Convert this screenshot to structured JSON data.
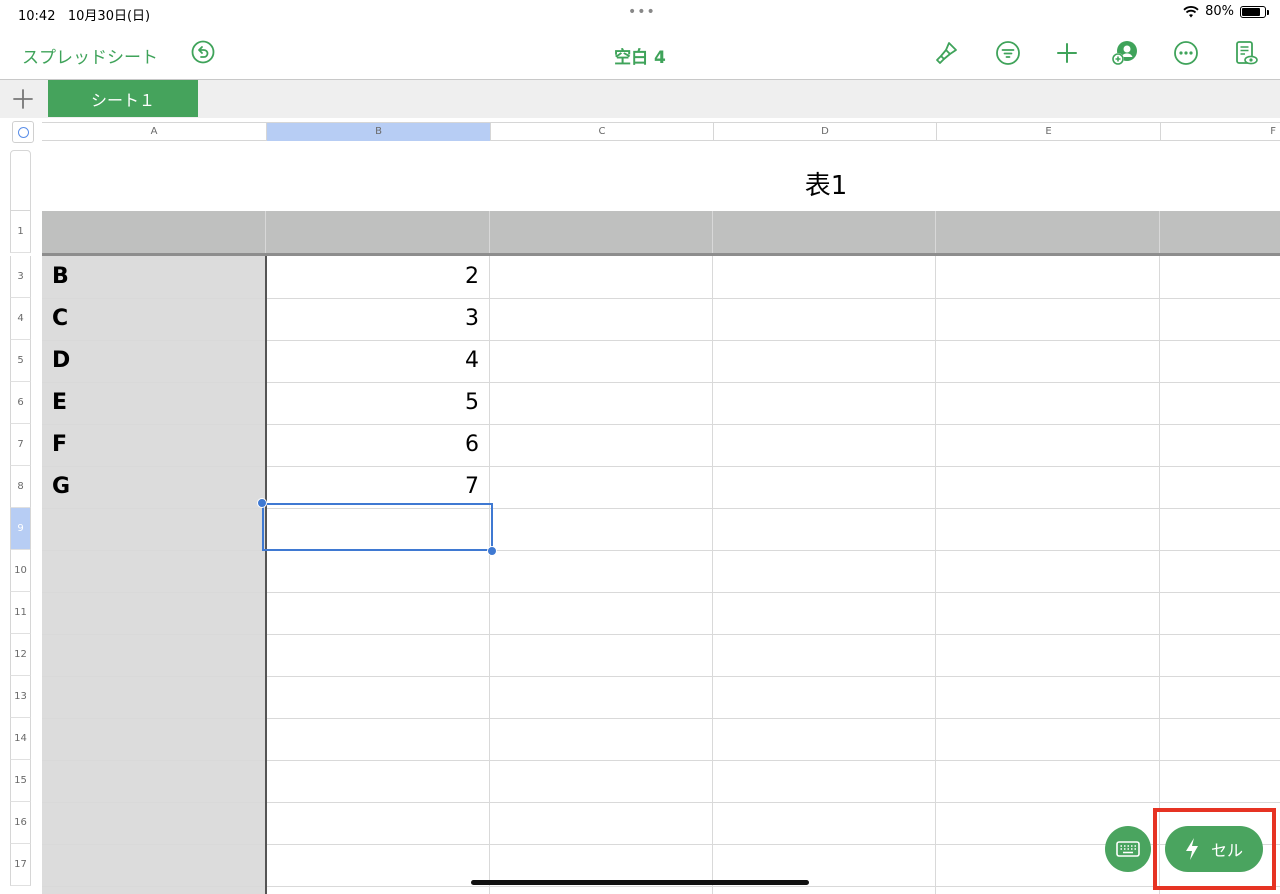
{
  "status_bar": {
    "time": "10:42",
    "date": "10月30日(日)",
    "battery_percent": "80%",
    "battery_level": 0.8
  },
  "toolbar": {
    "back_label": "スプレッドシート",
    "document_title": "空白 4",
    "icons": [
      "undo-icon",
      "format-brush-icon",
      "filter-icon",
      "add-icon",
      "collaborate-icon",
      "more-icon",
      "reader-view-icon"
    ],
    "accent_color": "#3fa35a"
  },
  "sheets": {
    "tabs": [
      {
        "label": "シート１",
        "active": true
      }
    ]
  },
  "grid": {
    "column_letters": [
      "A",
      "B",
      "C",
      "D",
      "E",
      "F"
    ],
    "selected_column": "B",
    "row_numbers": [
      "1",
      "3",
      "4",
      "5",
      "6",
      "7",
      "8",
      "9",
      "10",
      "11",
      "12",
      "13",
      "14",
      "15",
      "16",
      "17"
    ],
    "selected_row": "9",
    "table_title": "表1",
    "rows": [
      {
        "a": "B",
        "b": "2"
      },
      {
        "a": "C",
        "b": "3"
      },
      {
        "a": "D",
        "b": "4"
      },
      {
        "a": "E",
        "b": "5"
      },
      {
        "a": "F",
        "b": "6"
      },
      {
        "a": "G",
        "b": "7"
      }
    ]
  },
  "actions": {
    "keyboard_icon": "keyboard-icon",
    "cell_button_label": "セル",
    "cell_button_icon": "lightning-icon",
    "highlight_color": "#e63323"
  }
}
